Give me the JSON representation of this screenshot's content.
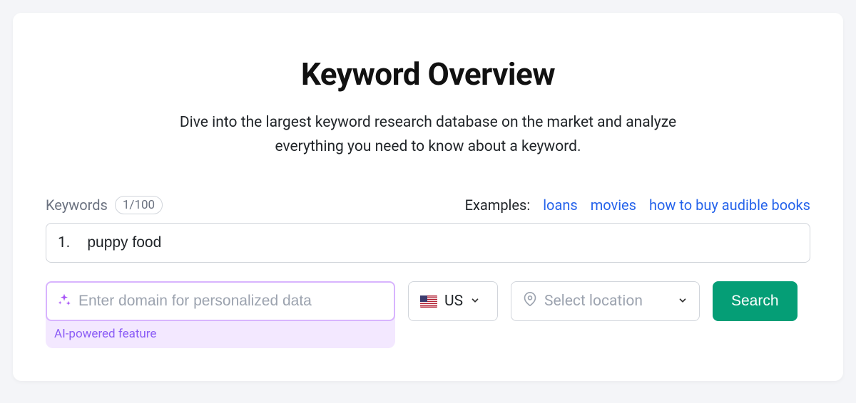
{
  "title": "Keyword Overview",
  "subtitle": "Dive into the largest keyword research database on the market and analyze everything you need to know about a keyword.",
  "keywords": {
    "label": "Keywords",
    "count_badge": "1/100",
    "row_number": "1.",
    "value": "puppy food"
  },
  "examples": {
    "label": "Examples:",
    "links": [
      "loans",
      "movies",
      "how to buy audible books"
    ]
  },
  "ai": {
    "placeholder": "Enter domain for personalized data",
    "caption": "AI-powered feature"
  },
  "country": {
    "code": "US"
  },
  "location": {
    "placeholder": "Select location"
  },
  "search_label": "Search"
}
